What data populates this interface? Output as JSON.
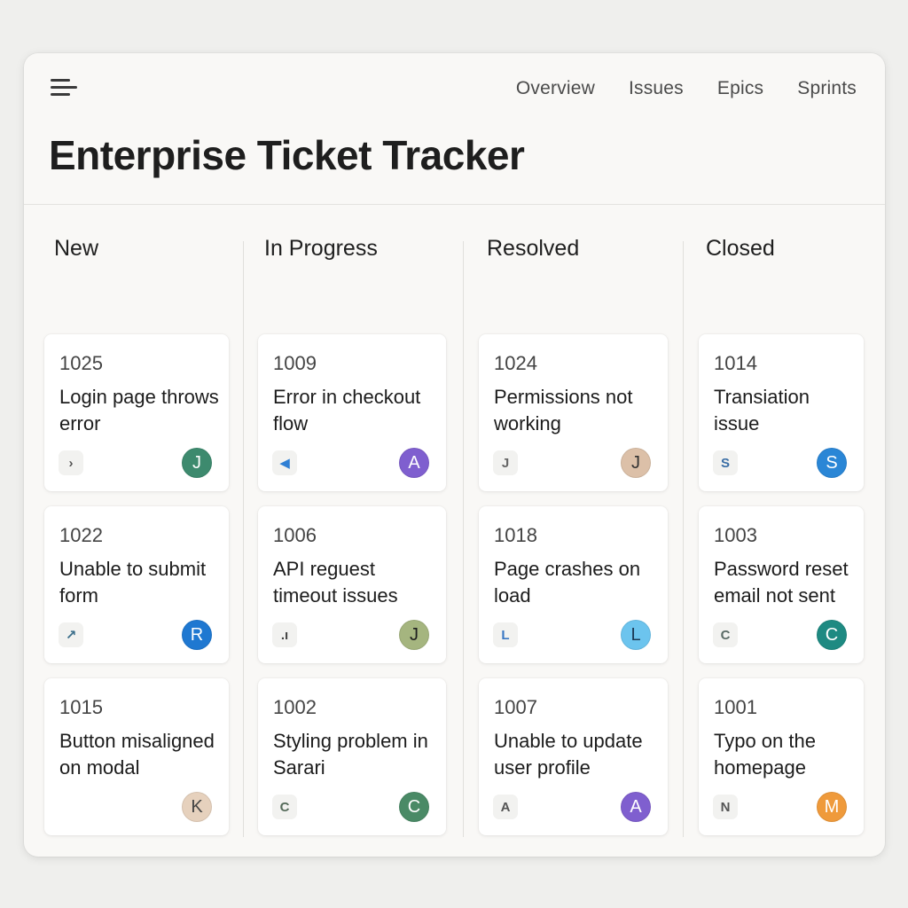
{
  "nav": {
    "links": [
      "Overview",
      "Issues",
      "Epics",
      "Sprints"
    ]
  },
  "page": {
    "title": "Enterprise Ticket Tracker"
  },
  "columns": [
    {
      "name": "New",
      "cards": [
        {
          "id": "1025",
          "title": "Login page throws error",
          "type_icon": "chevron-right-icon",
          "type_glyph": "›",
          "type_color": "#555555",
          "assignee": "J",
          "avatar_color": "#3d8a6e"
        },
        {
          "id": "1022",
          "title": "Unable to submit form",
          "type_icon": "arrow-up-right-icon",
          "type_glyph": "↗",
          "type_color": "#3a6e8a",
          "assignee": "R",
          "avatar_color": "#1f78d1"
        },
        {
          "id": "1015",
          "title": "Button misaligned on modal",
          "type_icon": "",
          "type_glyph": "",
          "type_color": "#555555",
          "assignee": "K",
          "avatar_color": "#e6d1bd",
          "avatar_text_color": "#444444"
        }
      ]
    },
    {
      "name": "In Progress",
      "cards": [
        {
          "id": "1009",
          "title": "Error in checkout flow",
          "type_icon": "flag-icon",
          "type_glyph": "◀",
          "type_color": "#2f7fd4",
          "assignee": "A",
          "avatar_color": "#7f5fcf"
        },
        {
          "id": "1006",
          "title": "API reguest timeout issues",
          "type_icon": "signal-bars-icon",
          "type_glyph": ".ı",
          "type_color": "#444444",
          "assignee": "J",
          "avatar_color": "#a5b57f",
          "avatar_text_color": "#1e1e1e"
        },
        {
          "id": "1002",
          "title": "Styling problem in Sarari",
          "type_icon": "letter-c-icon",
          "type_glyph": "C",
          "type_color": "#556b5a",
          "assignee": "C",
          "avatar_color": "#4a8a66"
        }
      ]
    },
    {
      "name": "Resolved",
      "cards": [
        {
          "id": "1024",
          "title": "Permissions not working",
          "type_icon": "letter-j-icon",
          "type_glyph": "J",
          "type_color": "#666666",
          "assignee": "J",
          "avatar_color": "#dcc0a8",
          "avatar_text_color": "#333333"
        },
        {
          "id": "1018",
          "title": "Page crashes on load",
          "type_icon": "letter-l-icon",
          "type_glyph": "L",
          "type_color": "#3a78c4",
          "assignee": "L",
          "avatar_color": "#6cc4ee",
          "avatar_text_color": "#1c3a55"
        },
        {
          "id": "1007",
          "title": "Unable to update user profile",
          "type_icon": "letter-a-icon",
          "type_glyph": "A",
          "type_color": "#555555",
          "assignee": "A",
          "avatar_color": "#7f5fcf"
        }
      ]
    },
    {
      "name": "Closed",
      "cards": [
        {
          "id": "1014",
          "title": "Transiation issue",
          "type_icon": "letter-s-icon",
          "type_glyph": "S",
          "type_color": "#3a6ea5",
          "assignee": "S",
          "avatar_color": "#2a86d6"
        },
        {
          "id": "1003",
          "title": "Password reset email not sent",
          "type_icon": "letter-c-icon",
          "type_glyph": "C",
          "type_color": "#5a6b66",
          "assignee": "C",
          "avatar_color": "#1e8a82"
        },
        {
          "id": "1001",
          "title": "Typo on the homepage",
          "type_icon": "letter-n-icon",
          "type_glyph": "N",
          "type_color": "#555555",
          "assignee": "M",
          "avatar_color": "#ef9a3b"
        }
      ]
    }
  ]
}
